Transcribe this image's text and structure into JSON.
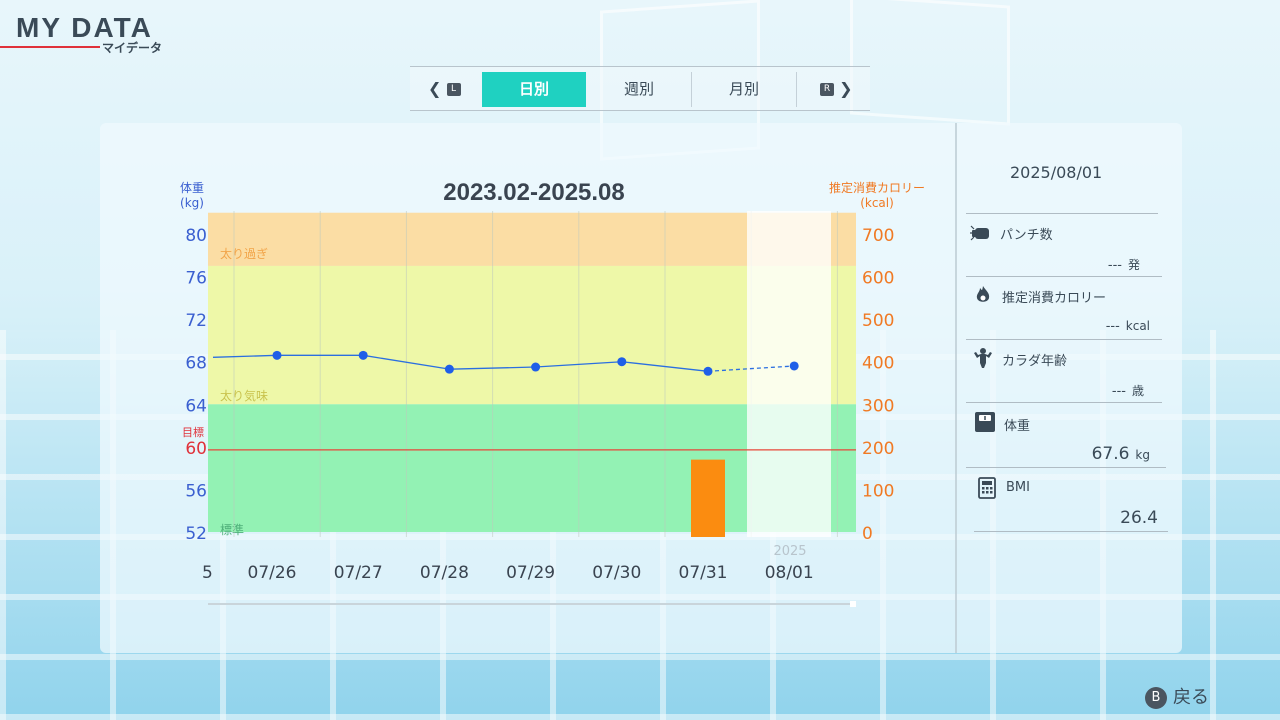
{
  "header": {
    "title": "MY DATA",
    "subtitle": "マイデータ"
  },
  "tabs": {
    "prev_key": "L",
    "next_key": "R",
    "items": [
      {
        "label": "日別",
        "active": true
      },
      {
        "label": "週別",
        "active": false
      },
      {
        "label": "月別",
        "active": false
      }
    ]
  },
  "chart_data": {
    "type": "line",
    "title": "2023.02-2025.08",
    "y_left_label": "体重",
    "y_left_unit": "(kg)",
    "y_right_label": "推定消費カロリー",
    "y_right_unit": "(kcal)",
    "y_left_ticks": [
      80,
      76,
      72,
      68,
      64,
      60,
      56,
      52
    ],
    "y_right_ticks": [
      700,
      600,
      500,
      400,
      300,
      200,
      100,
      0
    ],
    "ylim_left": [
      52,
      82
    ],
    "ylim_right": [
      0,
      760
    ],
    "target_label": "目標",
    "target_value": 60,
    "zones": [
      {
        "label": "太り過ぎ",
        "from": 77,
        "to": 82,
        "color": "#fbdda4"
      },
      {
        "label": "太り気味",
        "from": 64,
        "to": 77,
        "color": "#eef8a8"
      },
      {
        "label": "標準",
        "from": 52,
        "to": 64,
        "color": "#93f2b4"
      }
    ],
    "partial_first_label": "5",
    "categories": [
      "07/26",
      "07/27",
      "07/28",
      "07/29",
      "07/30",
      "07/31",
      "08/01"
    ],
    "year_label": "2025",
    "series": [
      {
        "values": [
          68.6,
          68.6,
          67.3,
          67.5,
          68.0,
          67.1,
          67.6
        ]
      }
    ],
    "bars": [
      {
        "category": "07/31",
        "value": 170
      }
    ]
  },
  "side": {
    "date": "2025/08/01",
    "items": [
      {
        "label": "パンチ数",
        "value": "---",
        "unit": "発"
      },
      {
        "label": "推定消費カロリー",
        "value": "---",
        "unit": "kcal"
      },
      {
        "label": "カラダ年齢",
        "value": "---",
        "unit": "歳"
      },
      {
        "label": "体重",
        "value": "67.6",
        "unit": "kg"
      },
      {
        "label": "BMI",
        "value": "26.4",
        "unit": ""
      }
    ]
  },
  "footer": {
    "back_key": "B",
    "back_label": "戻る"
  }
}
